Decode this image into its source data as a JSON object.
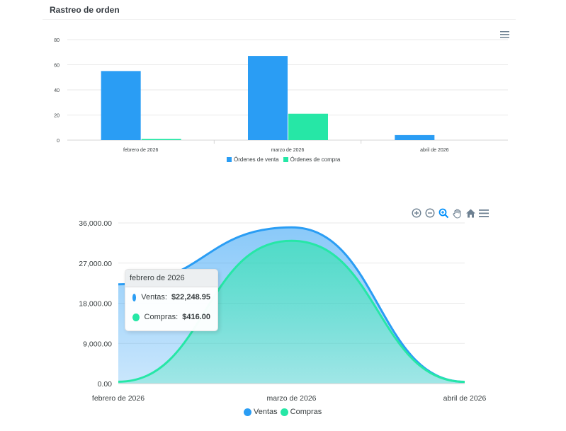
{
  "card": {
    "title": "Rastreo de orden"
  },
  "colors": {
    "blue": "#2a9df4",
    "green": "#26e7a6",
    "grid": "#e9e9e9",
    "axis": "#373d3f"
  },
  "icons": {
    "menu": "hamburger-menu-icon",
    "zoom_in": "zoom-in-icon",
    "zoom_out": "zoom-out-icon",
    "zoom_select": "magnifier-icon",
    "pan": "hand-pan-icon",
    "reset": "home-icon"
  },
  "chart_data": [
    {
      "type": "bar",
      "title": "",
      "categories": [
        "febrero de 2026",
        "marzo de 2026",
        "abril de 2026"
      ],
      "series": [
        {
          "name": "Órdenes de venta",
          "values": [
            55,
            67,
            4
          ]
        },
        {
          "name": "Órdenes de compra",
          "values": [
            1,
            21,
            0
          ]
        }
      ],
      "ylim": [
        0,
        80
      ],
      "yticks": [
        0,
        20,
        40,
        60,
        80
      ],
      "grid": true,
      "legend": "bottom-center"
    },
    {
      "type": "area",
      "title": "",
      "categories": [
        "febrero de 2026",
        "marzo de 2026",
        "abril de 2026"
      ],
      "series": [
        {
          "name": "Ventas",
          "values": [
            22248.95,
            35000,
            400
          ]
        },
        {
          "name": "Compras",
          "values": [
            416.0,
            32000,
            400
          ]
        }
      ],
      "ylim": [
        0,
        36000
      ],
      "yticks": [
        "0.00",
        "9,000.00",
        "18,000.00",
        "27,000.00",
        "36,000.00"
      ],
      "grid": true,
      "curve": "smooth",
      "legend": "bottom-center",
      "tooltip": {
        "title": "febrero de 2026",
        "rows": [
          {
            "label": "Ventas:",
            "value": "$22,248.95"
          },
          {
            "label": "Compras:",
            "value": "$416.00"
          }
        ]
      }
    }
  ]
}
